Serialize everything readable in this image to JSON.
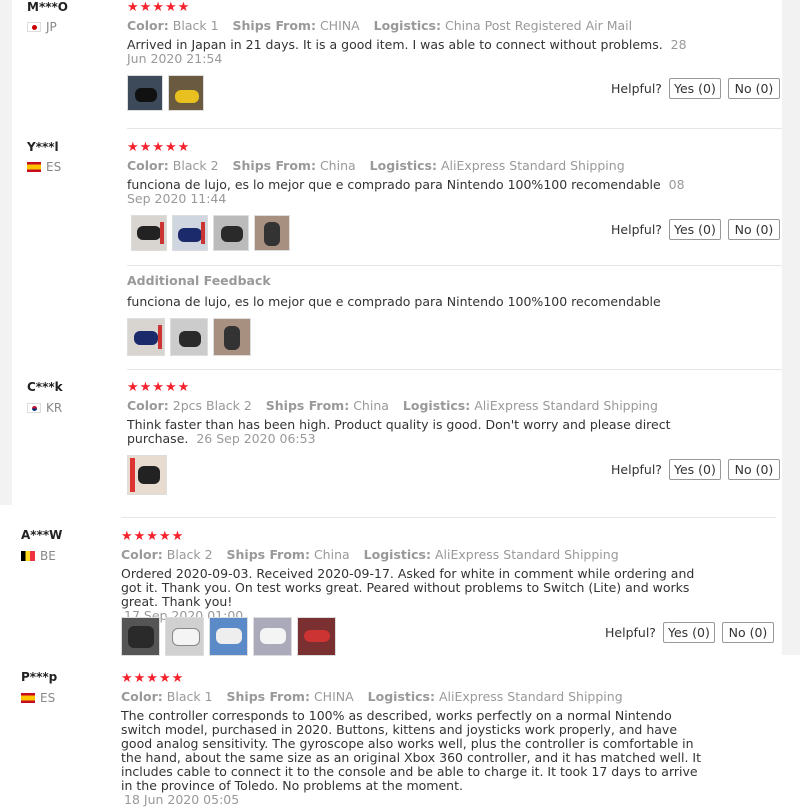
{
  "helpful_label": "Helpful?",
  "reviews": [
    {
      "user": "M***O",
      "country": "JP",
      "stars": "★★★★★",
      "color_label": "Color:",
      "color": "Black 1",
      "ships_label": "Ships From:",
      "ships": "CHINA",
      "logistics_label": "Logistics:",
      "logistics": "China Post Registered Air Mail",
      "text": "Arrived in Japan in 21 days. It is a good item. I was able to connect without problems.",
      "date": "28 Jun 2020 21:54",
      "yes": "Yes (0)",
      "no": "No (0)"
    },
    {
      "user": "Y***l",
      "country": "ES",
      "stars": "★★★★★",
      "color_label": "Color:",
      "color": "Black 2",
      "ships_label": "Ships From:",
      "ships": "China",
      "logistics_label": "Logistics:",
      "logistics": "AliExpress Standard Shipping",
      "text": "funciona de lujo, es lo mejor que e comprado para Nintendo 100%100 recomendable",
      "date": "08 Sep 2020 11:44",
      "yes": "Yes (0)",
      "no": "No (0)",
      "additional_label": "Additional Feedback",
      "additional_text": "funciona de lujo, es lo mejor que e comprado para Nintendo 100%100 recomendable"
    },
    {
      "user": "C***k",
      "country": "KR",
      "stars": "★★★★★",
      "color_label": "Color:",
      "color": "2pcs Black 2",
      "ships_label": "Ships From:",
      "ships": "China",
      "logistics_label": "Logistics:",
      "logistics": "AliExpress Standard Shipping",
      "text": "Think faster than has been high. Product quality is good. Don't worry and please direct purchase.",
      "date": "26 Sep 2020 06:53",
      "yes": "Yes (0)",
      "no": "No (0)"
    },
    {
      "user": "A***W",
      "country": "BE",
      "stars": "★★★★★",
      "color_label": "Color:",
      "color": "Black 2",
      "ships_label": "Ships From:",
      "ships": "China",
      "logistics_label": "Logistics:",
      "logistics": "AliExpress Standard Shipping",
      "text": "Ordered 2020-09-03. Received 2020-09-17. Asked for white in comment while ordering and got it. Thank you. On test works great. Peared without problems to Switch (Lite) and works great. Thank you!",
      "date": "17 Sep 2020 01:00",
      "yes": "Yes (0)",
      "no": "No (0)"
    },
    {
      "user": "P***p",
      "country": "ES",
      "stars": "★★★★★",
      "color_label": "Color:",
      "color": "Black 1",
      "ships_label": "Ships From:",
      "ships": "CHINA",
      "logistics_label": "Logistics:",
      "logistics": "AliExpress Standard Shipping",
      "text": "The controller corresponds to 100% as described, works perfectly on a normal Nintendo switch model, purchased in 2020. Buttons, kittens and joysticks work properly, and have good analog sensitivity. The gyroscope also works well, plus the controller is comfortable in the hand, about the same size as an original Xbox 360 controller, and it has matched well. It includes cable to connect it to the console and be able to charge it. It took 17 days to arrive in the province of Toledo. No problems at the moment.",
      "date": "18 Jun 2020 05:05"
    }
  ]
}
